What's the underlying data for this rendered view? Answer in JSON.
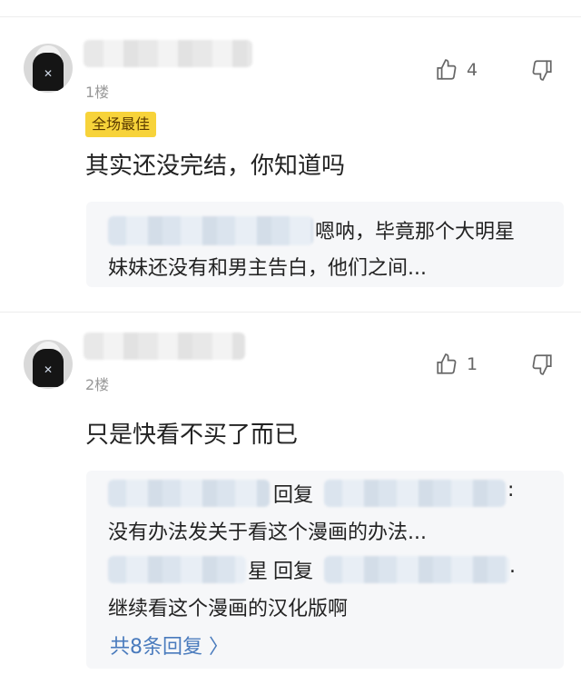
{
  "comments": [
    {
      "floor": "1楼",
      "badge": "全场最佳",
      "text": "其实还没完结，你知道吗",
      "likes": "4",
      "replies": [
        {
          "text": "嗯呐，毕竟那个大明星",
          "text2": "妹妹还没有和男主告白，他们之间..."
        }
      ]
    },
    {
      "floor": "2楼",
      "text": "只是快看不买了而已",
      "likes": "1",
      "replies": [
        {
          "reply_word": "回复",
          "colon": ":",
          "text": "没有办法发关于看这个漫画的办法..."
        },
        {
          "partial": "星",
          "reply_word": "回复",
          "colon": ".",
          "text": "继续看这个漫画的汉化版啊"
        }
      ],
      "more": "共8条回复 〉"
    }
  ],
  "icons": {
    "like": "thumbs-up-icon",
    "dislike": "thumbs-down-icon"
  },
  "colors": {
    "badge_bg": "#f7d33a",
    "link": "#4a7bbd",
    "reply_bg": "#f6f7f9"
  }
}
